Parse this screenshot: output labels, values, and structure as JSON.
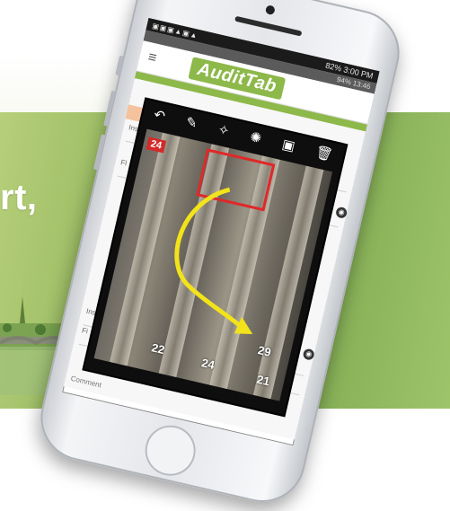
{
  "promo": {
    "headline_fragment": "rt,"
  },
  "phone": {
    "status_time": "3:00 PM",
    "status_battery": "82%",
    "sub_status_time": "13:46",
    "sub_status_battery": "94%"
  },
  "app": {
    "logo_text": "AuditTab",
    "menu_icon": "hamburger-icon"
  },
  "form": {
    "line1": "",
    "line2": "Ins",
    "line3": "Fl",
    "line4": "Ins",
    "line5": "Fi",
    "bottom_label": "Comment"
  },
  "editor": {
    "tools": [
      "undo-icon",
      "pen-icon",
      "magic-wand-icon",
      "palette-icon",
      "save-icon",
      "trash-icon"
    ],
    "tag_left": "24",
    "bin_labels": [
      "22",
      "24",
      "29",
      "21"
    ]
  },
  "colors": {
    "brand_green": "#8db84a",
    "annotation_red": "#e02828",
    "annotation_yellow": "#f2e31a"
  }
}
